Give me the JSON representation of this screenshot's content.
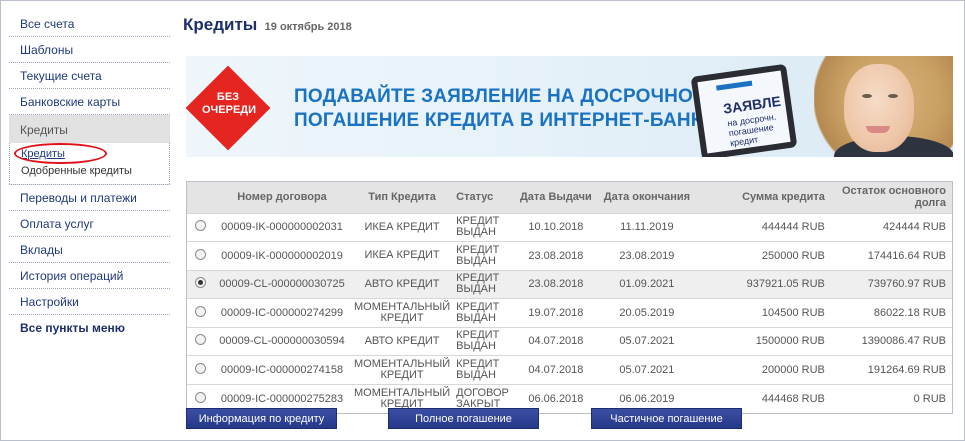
{
  "sidebar": {
    "items_top": [
      "Все счета",
      "Шаблоны",
      "Текущие счета",
      "Банковские карты"
    ],
    "group": {
      "title": "Кредиты",
      "subitems": [
        "Кредиты",
        "Одобренные кредиты"
      ]
    },
    "items_bottom": [
      "Переводы и платежи",
      "Оплата услуг",
      "Вклады",
      "История операций",
      "Настройки"
    ],
    "all_menu": "Все пункты меню"
  },
  "header": {
    "title": "Кредиты",
    "date": "19 октябрь 2018"
  },
  "banner": {
    "badge_line1": "БЕЗ",
    "badge_line2": "ОЧЕРЕДИ",
    "line1": "ПОДАВАЙТЕ ЗАЯВЛЕНИЕ НА ДОСРОЧНОЕ",
    "line2": "ПОГАШЕНИЕ КРЕДИТА В ИНТЕРНЕТ-БАНКЕ!",
    "device_line1": "ЗАЯВЛЕ",
    "device_line2": "на досрочн.",
    "device_line3": "погашение кредит"
  },
  "table": {
    "headers": [
      "Номер договора",
      "Тип Кредита",
      "Статус",
      "Дата Выдачи",
      "Дата окончания",
      "Сумма кредита",
      "Остаток основного долга"
    ],
    "rows": [
      {
        "selected": false,
        "number": "00009-IK-000000002031",
        "type": "ИКЕА КРЕДИТ",
        "status": "КРЕДИТ ВЫДАН",
        "issue": "10.10.2018",
        "end": "11.11.2019",
        "amount": "444444 RUB",
        "balance": "424444 RUB"
      },
      {
        "selected": false,
        "number": "00009-IK-000000002019",
        "type": "ИКЕА КРЕДИТ",
        "status": "КРЕДИТ ВЫДАН",
        "issue": "23.08.2018",
        "end": "23.08.2019",
        "amount": "250000 RUB",
        "balance": "174416.64 RUB"
      },
      {
        "selected": true,
        "number": "00009-CL-000000030725",
        "type": "АВТО КРЕДИТ",
        "status": "КРЕДИТ ВЫДАН",
        "issue": "23.08.2018",
        "end": "01.09.2021",
        "amount": "937921.05 RUB",
        "balance": "739760.97 RUB"
      },
      {
        "selected": false,
        "number": "00009-IC-000000274299",
        "type": "МОМЕНТАЛЬНЫЙ КРЕДИТ",
        "status": "КРЕДИТ ВЫДАН",
        "issue": "19.07.2018",
        "end": "20.05.2019",
        "amount": "104500 RUB",
        "balance": "86022.18 RUB"
      },
      {
        "selected": false,
        "number": "00009-CL-000000030594",
        "type": "АВТО КРЕДИТ",
        "status": "КРЕДИТ ВЫДАН",
        "issue": "04.07.2018",
        "end": "05.07.2021",
        "amount": "1500000 RUB",
        "balance": "1390086.47 RUB"
      },
      {
        "selected": false,
        "number": "00009-IC-000000274158",
        "type": "МОМЕНТАЛЬНЫЙ КРЕДИТ",
        "status": "КРЕДИТ ВЫДАН",
        "issue": "04.07.2018",
        "end": "05.07.2021",
        "amount": "200000 RUB",
        "balance": "191264.69 RUB"
      },
      {
        "selected": false,
        "number": "00009-IC-000000275283",
        "type": "МОМЕНТАЛЬНЫЙ КРЕДИТ",
        "status": "ДОГОВОР ЗАКРЫТ",
        "issue": "06.06.2018",
        "end": "06.06.2019",
        "amount": "444468 RUB",
        "balance": "0 RUB"
      }
    ]
  },
  "buttons": {
    "info": "Информация по кредиту",
    "full": "Полное погашение",
    "partial": "Частичное погашение"
  },
  "colors": {
    "accent": "#1c2f6b",
    "link": "#1f3a7a",
    "highlight_circle": "#e0101a",
    "badge": "#e52520",
    "banner_text": "#1a72c2"
  }
}
